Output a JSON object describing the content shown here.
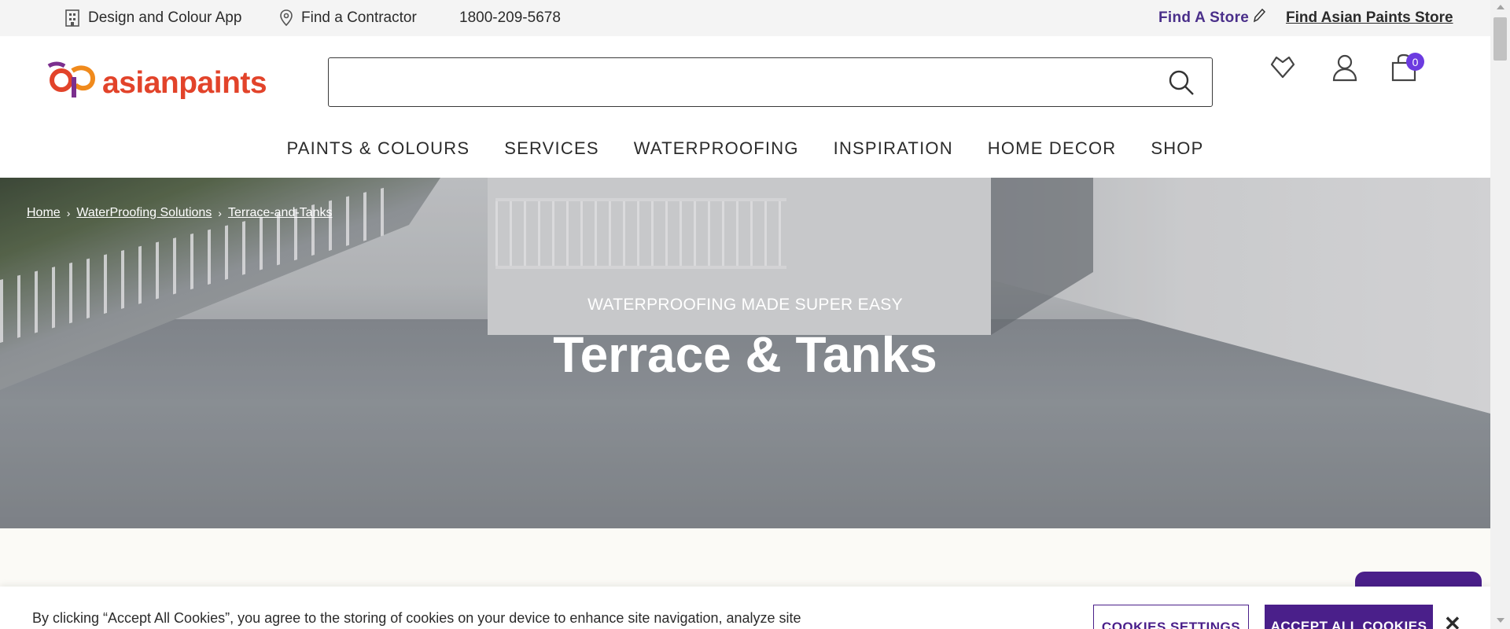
{
  "utility_bar": {
    "design_app": "Design and Colour App",
    "find_contractor": "Find a Contractor",
    "phone": "1800-209-5678",
    "find_a_store": "Find A Store",
    "find_ap_store": "Find Asian Paints Store"
  },
  "header": {
    "logo_text": "asianpaints",
    "search_placeholder": "",
    "cart_count": "0"
  },
  "nav": {
    "items": [
      "PAINTS & COLOURS",
      "SERVICES",
      "WATERPROOFING",
      "INSPIRATION",
      "HOME DECOR",
      "SHOP"
    ]
  },
  "breadcrumb": {
    "items": [
      "Home",
      "WaterProofing Solutions",
      "Terrace-and-Tanks"
    ]
  },
  "hero": {
    "subtitle": "WATERPROOFING MADE SUPER EASY",
    "title": "Terrace & Tanks"
  },
  "cookie_bar": {
    "text": "By clicking “Accept All Cookies”, you agree to the storing of cookies on your device to enhance site navigation, analyze site",
    "settings_label": "COOKIES SETTINGS",
    "accept_label": "ACCEPT ALL COOKIES",
    "close_label": "✕"
  },
  "colors": {
    "brand_purple": "#4a1f8a",
    "logo_red": "#e2432a",
    "badge_purple": "#6c3be0"
  }
}
